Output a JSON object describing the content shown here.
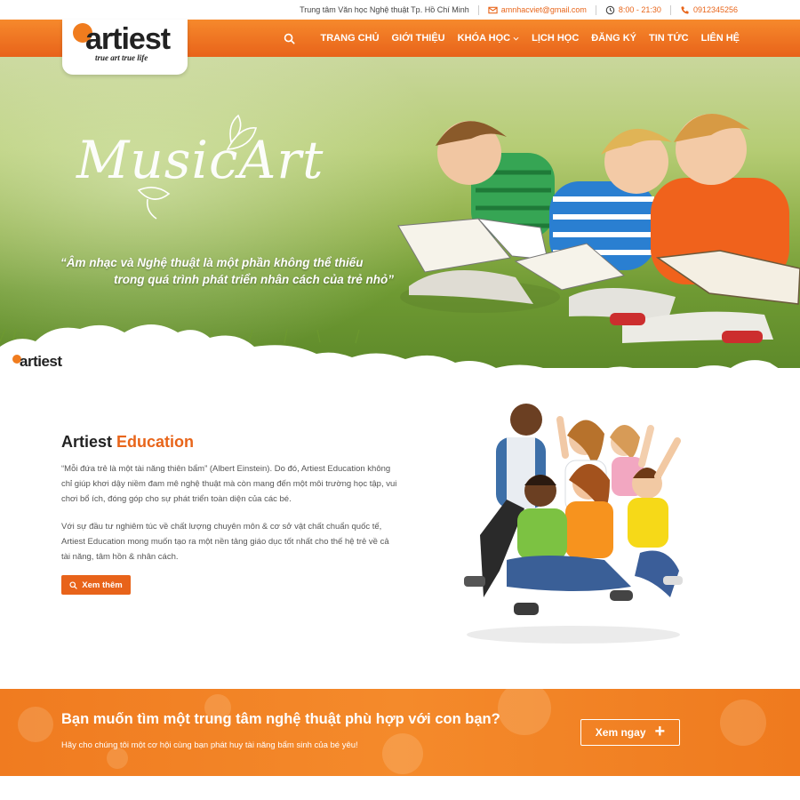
{
  "topbar": {
    "center_name": "Trung tâm Văn học Nghệ thuật Tp. Hồ Chí Minh",
    "email": "amnhacviet@gmail.com",
    "hours": "8:00 - 21:30",
    "phone": "0912345256"
  },
  "logo": {
    "word": "artiest",
    "tagline": "true art   true life"
  },
  "nav": {
    "items": [
      "TRANG CHỦ",
      "GIỚI THIỆU",
      "KHÓA HỌC",
      "LỊCH HỌC",
      "ĐĂNG KÝ",
      "TIN TỨC",
      "LIÊN HỆ"
    ],
    "dropdown_index": 2
  },
  "hero": {
    "script_title": "MusicArt",
    "quote_line1": "“Âm nhạc và Nghệ thuật là một phần không thể thiếu",
    "quote_line2": "trong quá trình phát triển nhân cách của trẻ nhỏ”"
  },
  "small_logo": "artiest",
  "about": {
    "title_main": "Artiest",
    "title_highlight": "Education",
    "paragraph1": "“Mỗi đứa trẻ là một tài năng thiên bẩm” (Albert Einstein). Do đó, Artiest Education không chỉ giúp khơi dậy niềm đam mê nghệ thuật mà còn mang đến một môi trường học tập, vui chơi bổ ích, đóng góp cho sự phát triển toàn diện của các bé.",
    "paragraph2": "Với sự đầu tư nghiêm túc về chất lượng chuyên môn & cơ sở vật chất chuẩn quốc tế, Artiest Education mong muốn tạo ra một nền tảng giáo dục tốt nhất cho thế hệ trẻ về cả tài năng, tâm hồn & nhân cách.",
    "button_label": "Xem thêm"
  },
  "cta": {
    "title": "Bạn muốn tìm một trung tâm nghệ thuật phù hợp với con bạn?",
    "subtitle": "Hãy cho chúng tôi một cơ hội cùng bạn phát huy tài năng bẩm sinh của bé yêu!",
    "button_label": "Xem ngay"
  },
  "colors": {
    "accent": "#e8651a",
    "nav_top": "#f6892c",
    "nav_bottom": "#e8631a"
  }
}
